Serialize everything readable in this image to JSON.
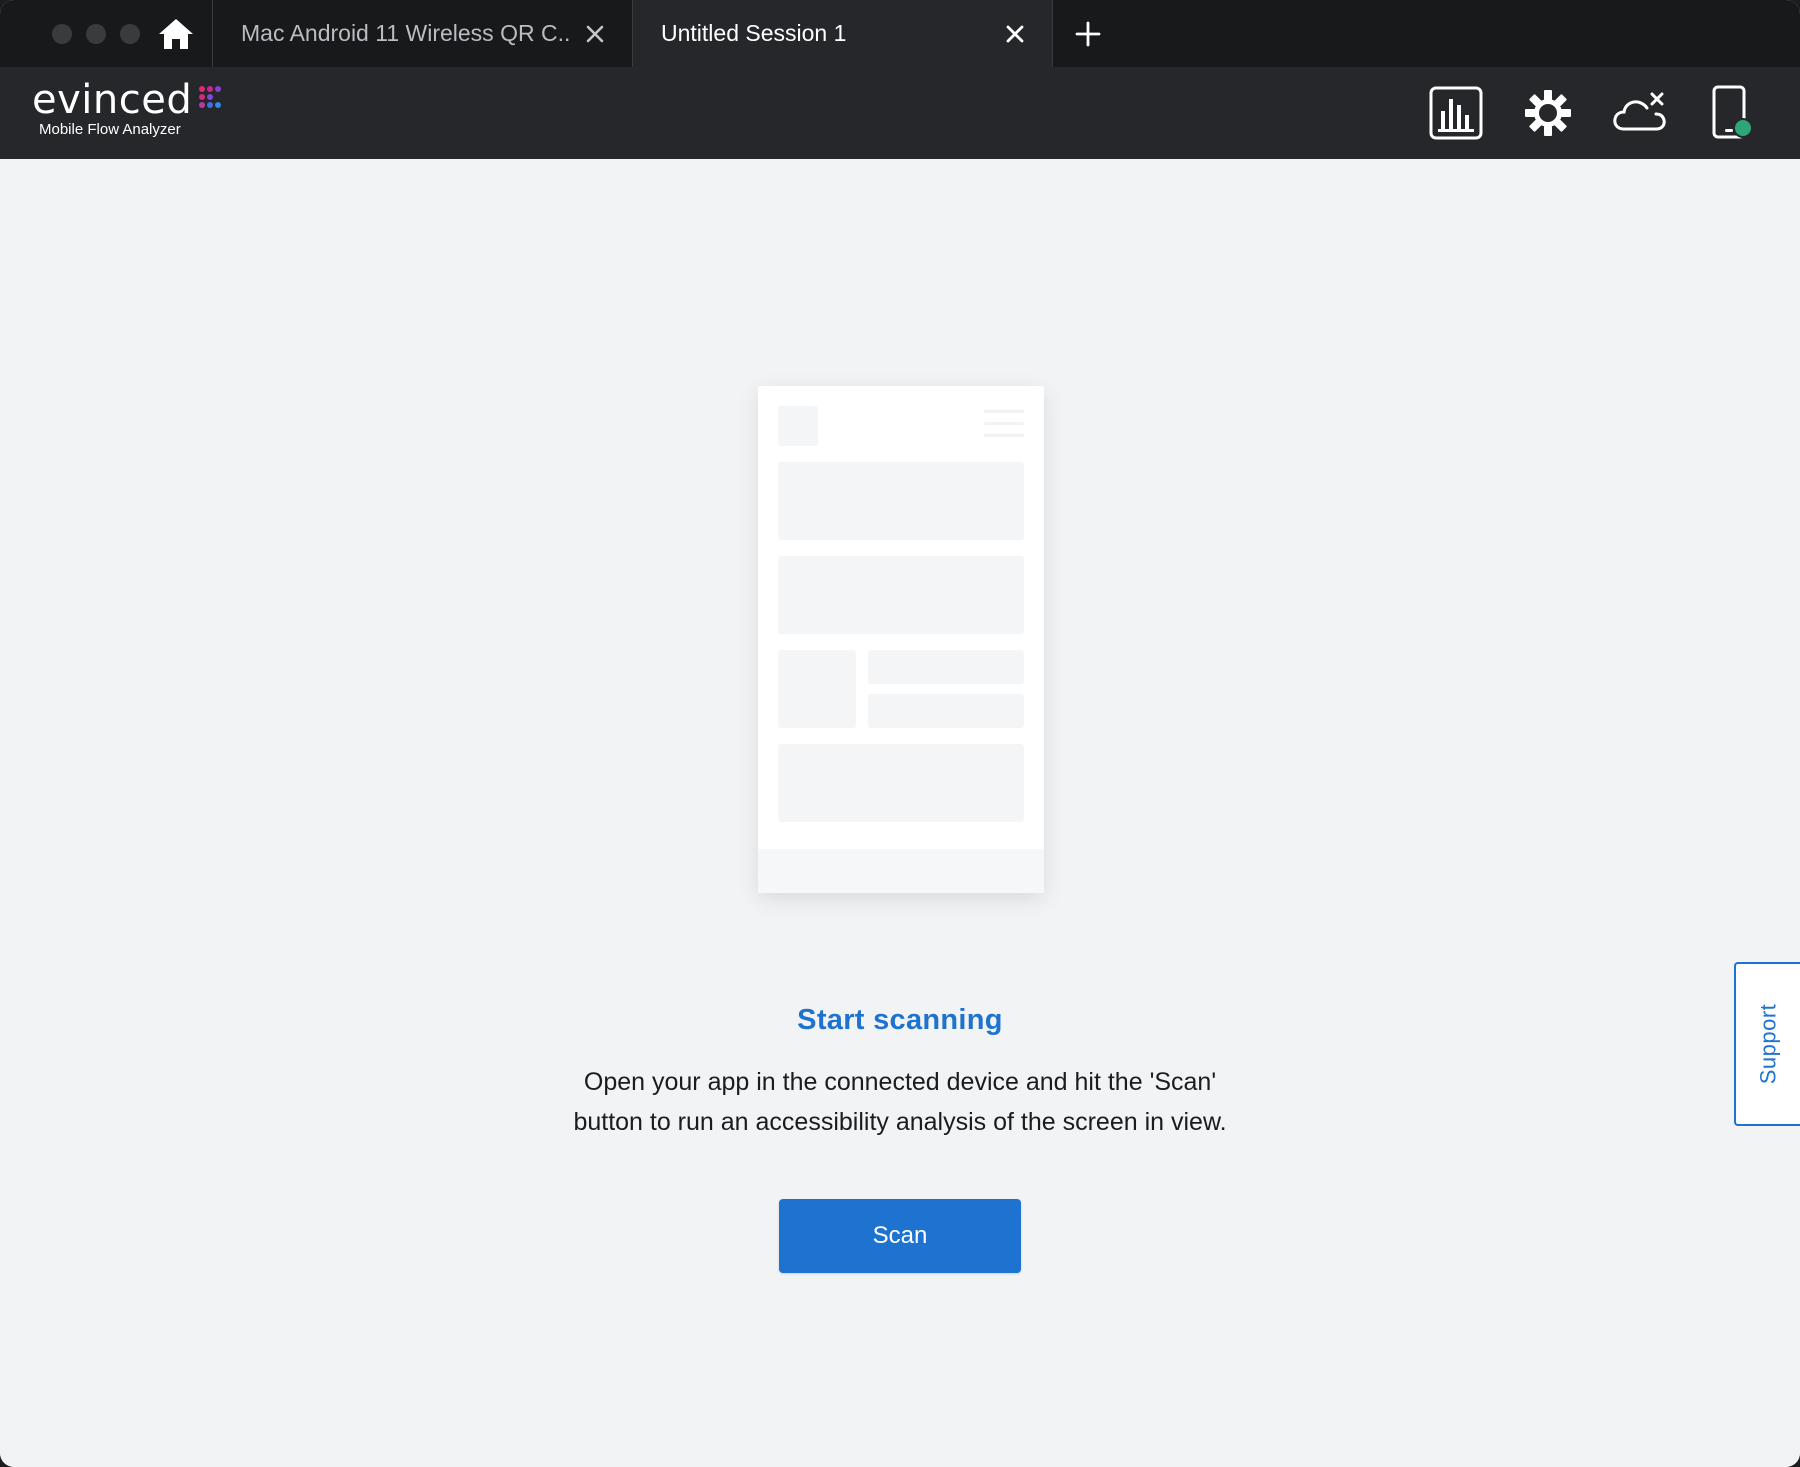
{
  "window": {
    "traffic_lights": [
      "close",
      "minimize",
      "zoom"
    ]
  },
  "tabs": [
    {
      "label": "Mac Android 11 Wireless QR C...",
      "active": false,
      "close_icon": "close-icon"
    },
    {
      "label": "Untitled Session 1",
      "active": true,
      "close_icon": "close-icon"
    }
  ],
  "tabbar": {
    "home_icon": "home-icon",
    "new_tab_icon": "plus-icon"
  },
  "header": {
    "logo_text": "evinced",
    "logo_subtitle": "Mobile Flow Analyzer",
    "actions": [
      {
        "name": "reports",
        "icon": "bar-chart-icon"
      },
      {
        "name": "settings",
        "icon": "gear-icon"
      },
      {
        "name": "cloud-disconnected",
        "icon": "cloud-x-icon"
      },
      {
        "name": "device-connected",
        "icon": "phone-status-icon",
        "status_color": "#2fa67a"
      }
    ]
  },
  "main": {
    "empty_state": {
      "title": "Start scanning",
      "description_line1": "Open your app in the connected device and hit the 'Scan'",
      "description_line2": "button to run an accessibility analysis of the screen in view.",
      "scan_label": "Scan"
    },
    "support_label": "Support"
  },
  "colors": {
    "accent": "#1f73d0",
    "titlebar": "#18191b",
    "header": "#26272a",
    "background": "#f1f3f5",
    "device_status": "#2fa67a"
  }
}
